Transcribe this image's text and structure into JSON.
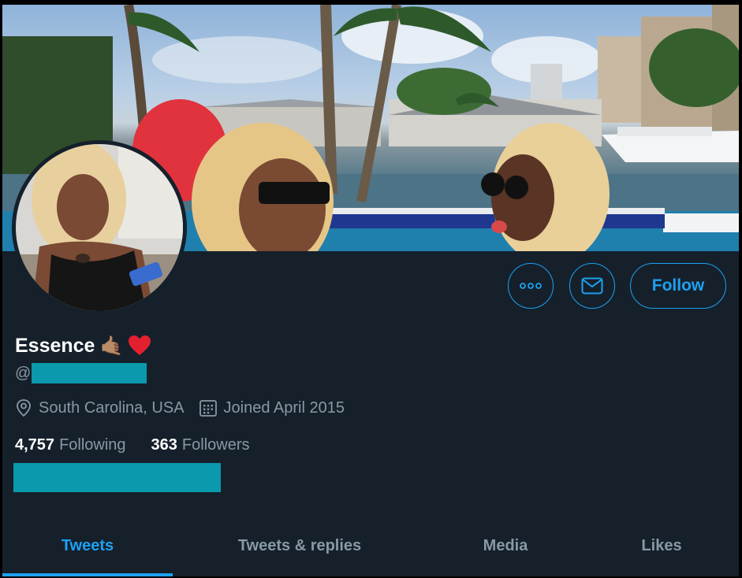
{
  "profile": {
    "display_name": "Essence",
    "name_emojis": "🤙🏽",
    "handle_prefix": "@",
    "location": "South Carolina, USA",
    "joined": "Joined April 2015"
  },
  "stats": {
    "following_count": "4,757",
    "following_label": "Following",
    "followers_count": "363",
    "followers_label": "Followers"
  },
  "actions": {
    "follow_label": "Follow"
  },
  "tabs": [
    {
      "label": "Tweets",
      "active": true
    },
    {
      "label": "Tweets & replies",
      "active": false
    },
    {
      "label": "Media",
      "active": false
    },
    {
      "label": "Likes",
      "active": false
    }
  ],
  "colors": {
    "background": "#15202b",
    "accent": "#1da1f2",
    "muted_text": "#8899a6",
    "redaction": "#0a99ad"
  },
  "icons": [
    "more-icon",
    "envelope-icon",
    "location-pin-icon",
    "calendar-icon",
    "heart-emoji"
  ]
}
